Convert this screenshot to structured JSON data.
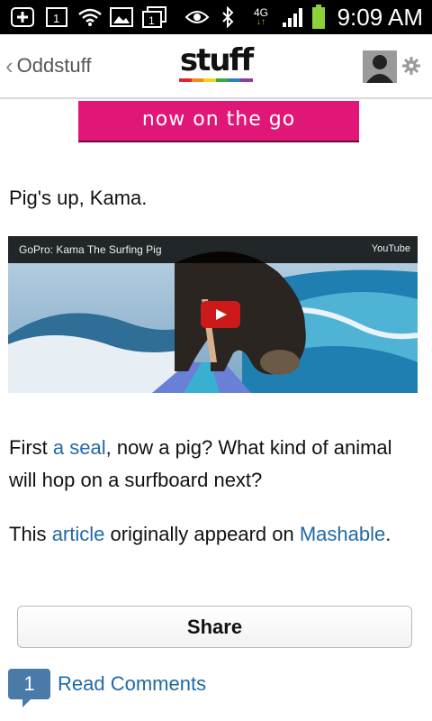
{
  "status_bar": {
    "time": "9:09 AM",
    "network_label": "4G",
    "notification_counts": [
      "1",
      "1"
    ],
    "icons": [
      "add-icon",
      "calendar-icon",
      "wifi-icon",
      "image-icon",
      "window-icon",
      "eye-icon",
      "bluetooth-icon",
      "network-icon",
      "signal-icon",
      "battery-icon"
    ]
  },
  "nav": {
    "back_label": "Oddstuff",
    "logo_text": "stuff",
    "logo_colors": [
      "#e3262e",
      "#f08a1c",
      "#f4d21d",
      "#3ca64a",
      "#2d7fc1",
      "#8b3fa0"
    ]
  },
  "banner": {
    "text": "now on the go",
    "color": "#e01777"
  },
  "article": {
    "intro": "Pig's up, Kama.",
    "video": {
      "title": "GoPro: Kama The Surfing Pig",
      "source": "YouTube"
    },
    "para1": {
      "before": "First ",
      "link": "a seal",
      "after": ", now a pig? What kind of animal will hop on a surfboard next?"
    },
    "para2": {
      "before": "This ",
      "link": "article",
      "middle": " originally appeard on ",
      "link2": "Mashable",
      "after": "."
    }
  },
  "share_label": "Share",
  "comments": {
    "count": "1",
    "label": "Read Comments"
  },
  "colors": {
    "link": "#1f69a8",
    "comment_bubble": "#4a7aa8"
  }
}
